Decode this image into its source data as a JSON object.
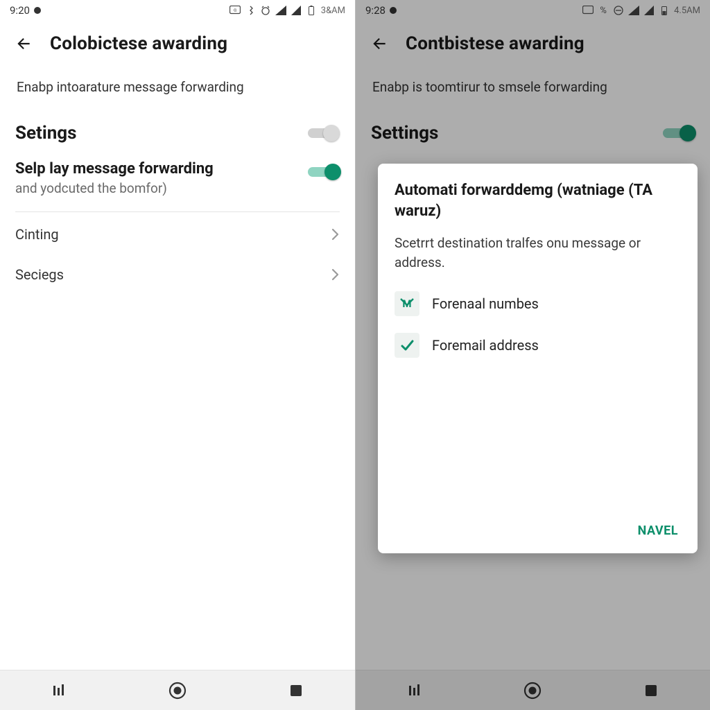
{
  "left": {
    "status": {
      "time": "9:20",
      "ampm": "3&AM"
    },
    "appbar": {
      "title": "Colobictese awarding"
    },
    "desc": "Enabp intoarature message forwarding",
    "settings_label": "Setings",
    "forward": {
      "title": "Selp lay message forwarding",
      "sub": "and yodcuted the bomfor)"
    },
    "items": [
      {
        "label": "Cinting"
      },
      {
        "label": "Seciegs"
      }
    ]
  },
  "right": {
    "status": {
      "time": "9:28",
      "ampm": "4.5AM"
    },
    "appbar": {
      "title": "Contbistese awarding"
    },
    "desc": "Enabp is toomtirur to smsele forwarding",
    "settings_label": "Settings",
    "dialog": {
      "title": "Automati forwarddemg (watniage (TA waruz)",
      "body": "Scetrrt destination tralfes onu message or address.",
      "options": [
        {
          "icon": "M",
          "label": "Forenaal numbes"
        },
        {
          "icon": "check",
          "label": "Foremail address"
        }
      ],
      "action": "NAVEL"
    }
  },
  "accent": "#0d8f6b"
}
